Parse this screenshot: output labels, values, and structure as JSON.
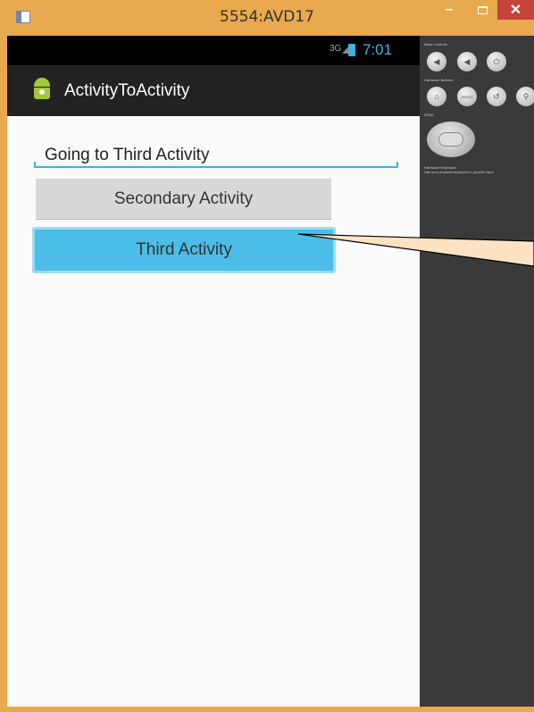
{
  "window": {
    "title": "5554:AVD17",
    "minimize": "–",
    "close": "✕"
  },
  "status_bar": {
    "network": "3G",
    "time": "7:01"
  },
  "action_bar": {
    "title": "ActivityToActivity"
  },
  "content": {
    "edit_text_value": "Going to Third Activity",
    "secondary_button": "Secondary Activity",
    "third_button": "Third Activity"
  },
  "controls": {
    "basic_controls": "Basic Controls",
    "hardware_buttons": "Hardware Buttons",
    "menu": "MENU",
    "dpad": "DPAD",
    "hardware_keyboard": "Hardware Keyboard",
    "keyboard_hint": "Use your physical keyboard to provide input"
  },
  "colors": {
    "frame": "#e9a94e",
    "accent": "#3fb2e0",
    "pressed_button": "#4bbde8",
    "close": "#c7423a"
  }
}
